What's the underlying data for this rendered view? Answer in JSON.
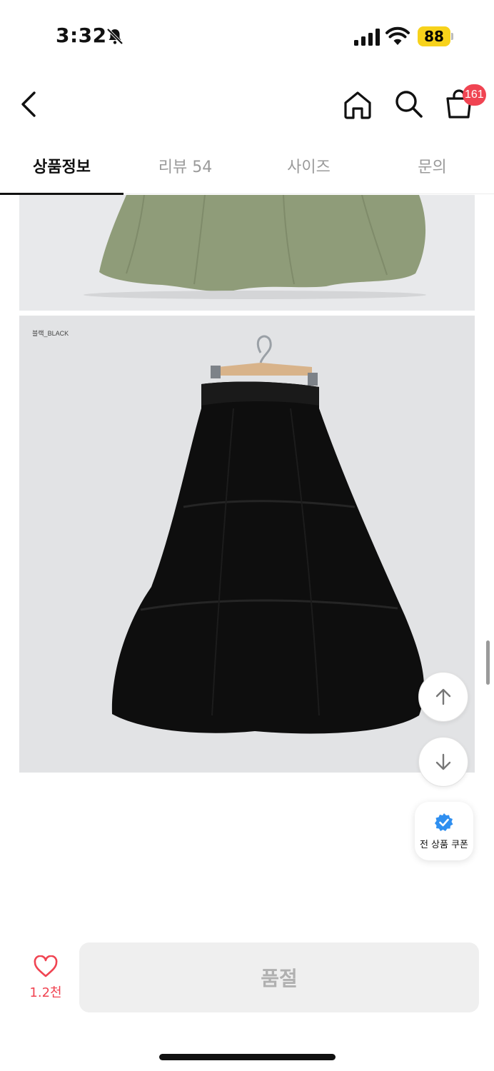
{
  "status_bar": {
    "time": "3:32",
    "battery": "88"
  },
  "header": {
    "cart_count": "161"
  },
  "tabs": [
    {
      "label": "상품정보",
      "active": true
    },
    {
      "label": "리뷰 54",
      "active": false
    },
    {
      "label": "사이즈",
      "active": false
    },
    {
      "label": "문의",
      "active": false
    }
  ],
  "content": {
    "photo_caption": "블랙_BLACK"
  },
  "floating": {
    "coupon_label": "전 상품 쿠폰"
  },
  "bottom_bar": {
    "wish_count": "1.2천",
    "action_label": "품절"
  },
  "colors": {
    "accent": "#f04452",
    "coupon_badge": "#2f8ff0",
    "battery": "#f7d21b"
  }
}
